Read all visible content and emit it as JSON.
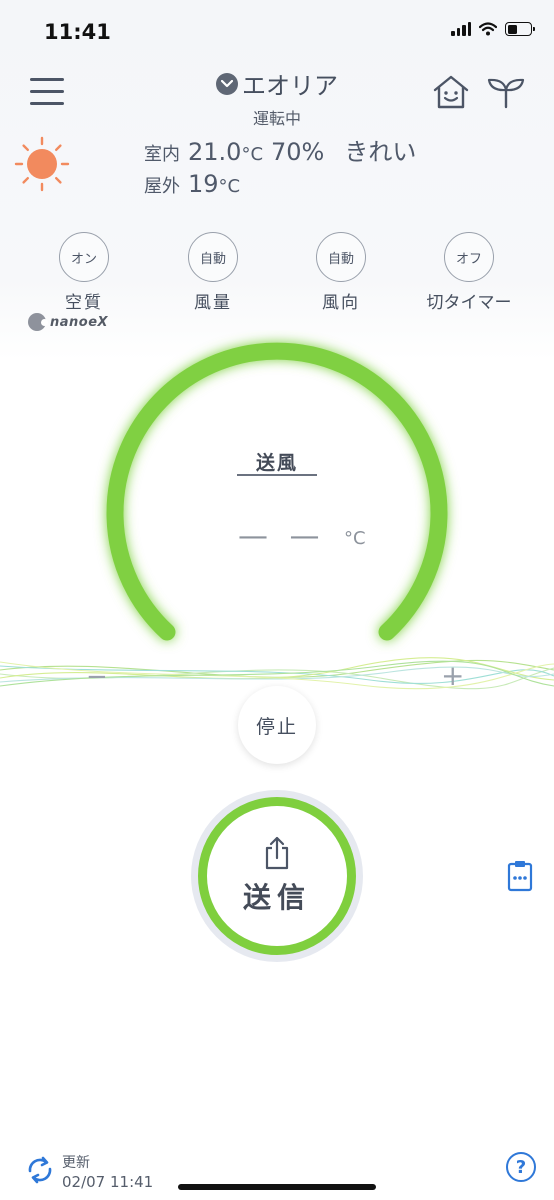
{
  "status_bar": {
    "time": "11:41",
    "battery_level": 0.45
  },
  "header": {
    "device_name": "エオリア",
    "device_status": "運転中",
    "icons": [
      "menu-icon",
      "chevron-down-icon",
      "home-smile-icon",
      "sprout-icon"
    ]
  },
  "weather": {
    "icon": "sun-icon",
    "indoor_label": "室内",
    "indoor_temp": "21.0",
    "indoor_unit": "°C",
    "humidity": "70%",
    "air_status": "きれい",
    "outdoor_label": "屋外",
    "outdoor_temp": "19",
    "outdoor_unit": "°C"
  },
  "functions": [
    {
      "state": "オン",
      "label": "空質"
    },
    {
      "state": "自動",
      "label": "風量"
    },
    {
      "state": "自動",
      "label": "風向"
    },
    {
      "state": "オフ",
      "label": "切タイマー"
    }
  ],
  "brand": {
    "nanoe": "nanoeX"
  },
  "dial": {
    "mode": "送風",
    "temp": "— —",
    "unit": "°C",
    "minus": "−",
    "plus": "+",
    "accent": "#7fcf3e"
  },
  "stop_button": {
    "label": "停止"
  },
  "send_button": {
    "label": "送信",
    "icon": "share-icon"
  },
  "footer": {
    "update_label": "更新",
    "update_time": "02/07 11:41",
    "help": "?"
  }
}
